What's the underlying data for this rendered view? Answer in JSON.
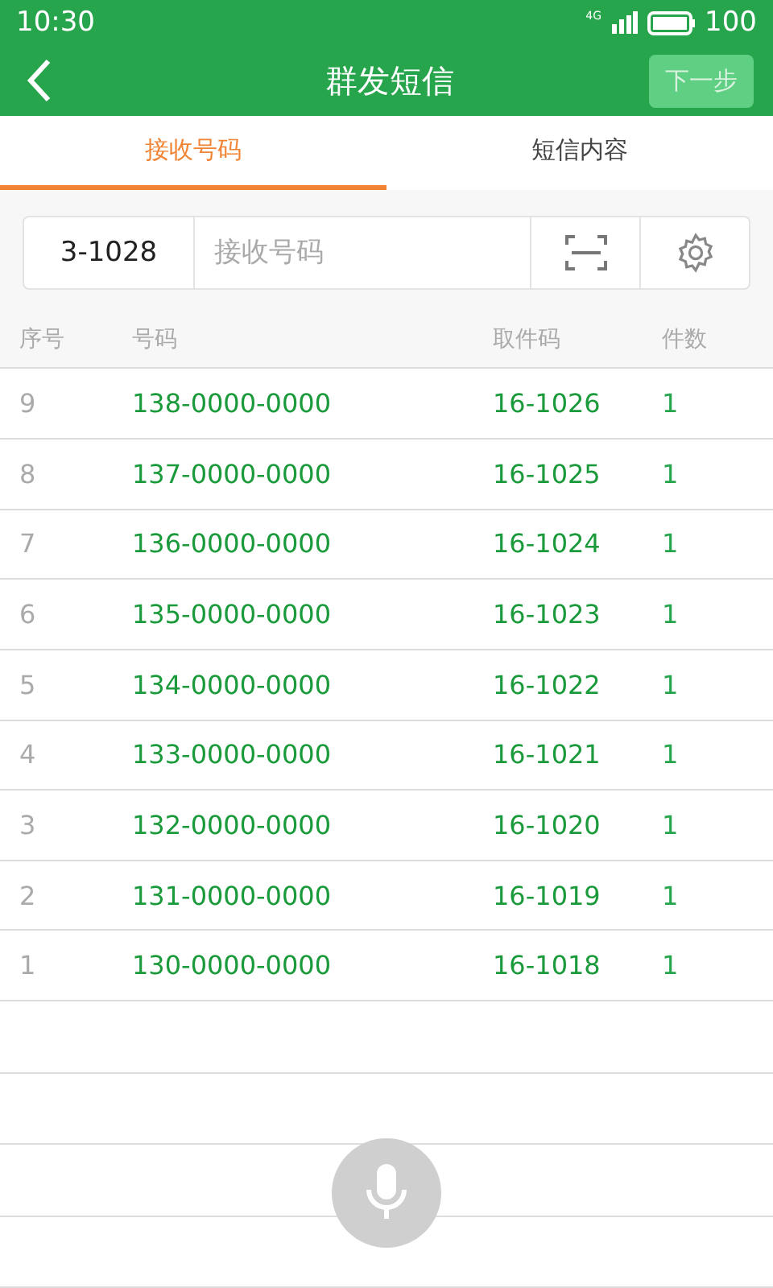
{
  "status_bar": {
    "time": "10:30",
    "network": "4G",
    "battery": "100"
  },
  "header": {
    "title": "群发短信",
    "next_button": {
      "label": "下一步",
      "disabled": true
    }
  },
  "tabs": [
    {
      "label": "接收号码",
      "selected": true
    },
    {
      "label": "短信内容",
      "selected": false
    }
  ],
  "input_bar": {
    "prefix": "3-1028",
    "placeholder": "接收号码"
  },
  "table": {
    "columns": [
      "序号",
      "号码",
      "取件码",
      "件数"
    ],
    "rows": [
      [
        "9",
        "138-0000-0000",
        "16-1026",
        "1"
      ],
      [
        "8",
        "137-0000-0000",
        "16-1025",
        "1"
      ],
      [
        "7",
        "136-0000-0000",
        "16-1024",
        "1"
      ],
      [
        "6",
        "135-0000-0000",
        "16-1023",
        "1"
      ],
      [
        "5",
        "134-0000-0000",
        "16-1022",
        "1"
      ],
      [
        "4",
        "133-0000-0000",
        "16-1021",
        "1"
      ],
      [
        "3",
        "132-0000-0000",
        "16-1020",
        "1"
      ],
      [
        "2",
        "131-0000-0000",
        "16-1019",
        "1"
      ],
      [
        "1",
        "130-0000-0000",
        "16-1018",
        "1"
      ]
    ]
  }
}
